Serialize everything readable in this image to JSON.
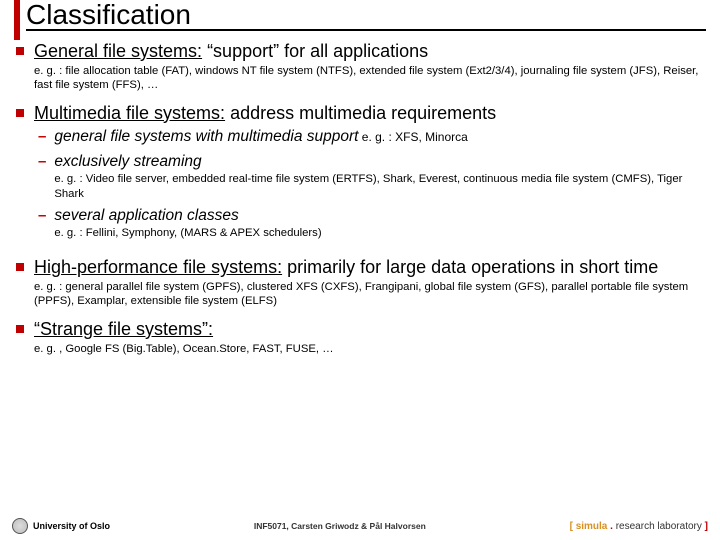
{
  "title": "Classification",
  "items": [
    {
      "heading_pre": "General file systems:",
      "heading_post": " “support” for all applications",
      "sub": "e. g. : file allocation table (FAT), windows NT file system (NTFS), extended file system (Ext2/3/4), journaling file system (JFS), Reiser, fast file system (FFS), …"
    },
    {
      "heading_pre": "Multimedia file systems:",
      "heading_post": " address multimedia requirements",
      "dashes": [
        {
          "title": "general file systems with multimedia support",
          "tail": " e. g. : XFS, Minorca",
          "sub": ""
        },
        {
          "title": "exclusively streaming",
          "tail": "",
          "sub": "e. g. : Video file server, embedded real-time file system (ERTFS),  Shark, Everest, continuous media file system (CMFS), Tiger Shark"
        },
        {
          "title": "several application classes",
          "tail": "",
          "sub": "e. g. : Fellini, Symphony, (MARS & APEX schedulers)"
        }
      ]
    },
    {
      "heading_pre": "High-performance file systems:",
      "heading_post": " primarily for large data operations in short time",
      "sub": "e. g. : general parallel file system (GPFS), clustered XFS (CXFS), Frangipani, global file system (GFS), parallel portable file system (PPFS), Examplar, extensible file system (ELFS)"
    },
    {
      "heading_pre": "“Strange file systems”:",
      "heading_post": "",
      "sub": "e. g. , Google FS (Big.Table), Ocean.Store, FAST, FUSE, …"
    }
  ],
  "footer": {
    "left": "University of Oslo",
    "center": "INF5071,  Carsten Griwodz & Pål Halvorsen",
    "right_sim": "simula",
    "right_lab": "research laboratory"
  }
}
